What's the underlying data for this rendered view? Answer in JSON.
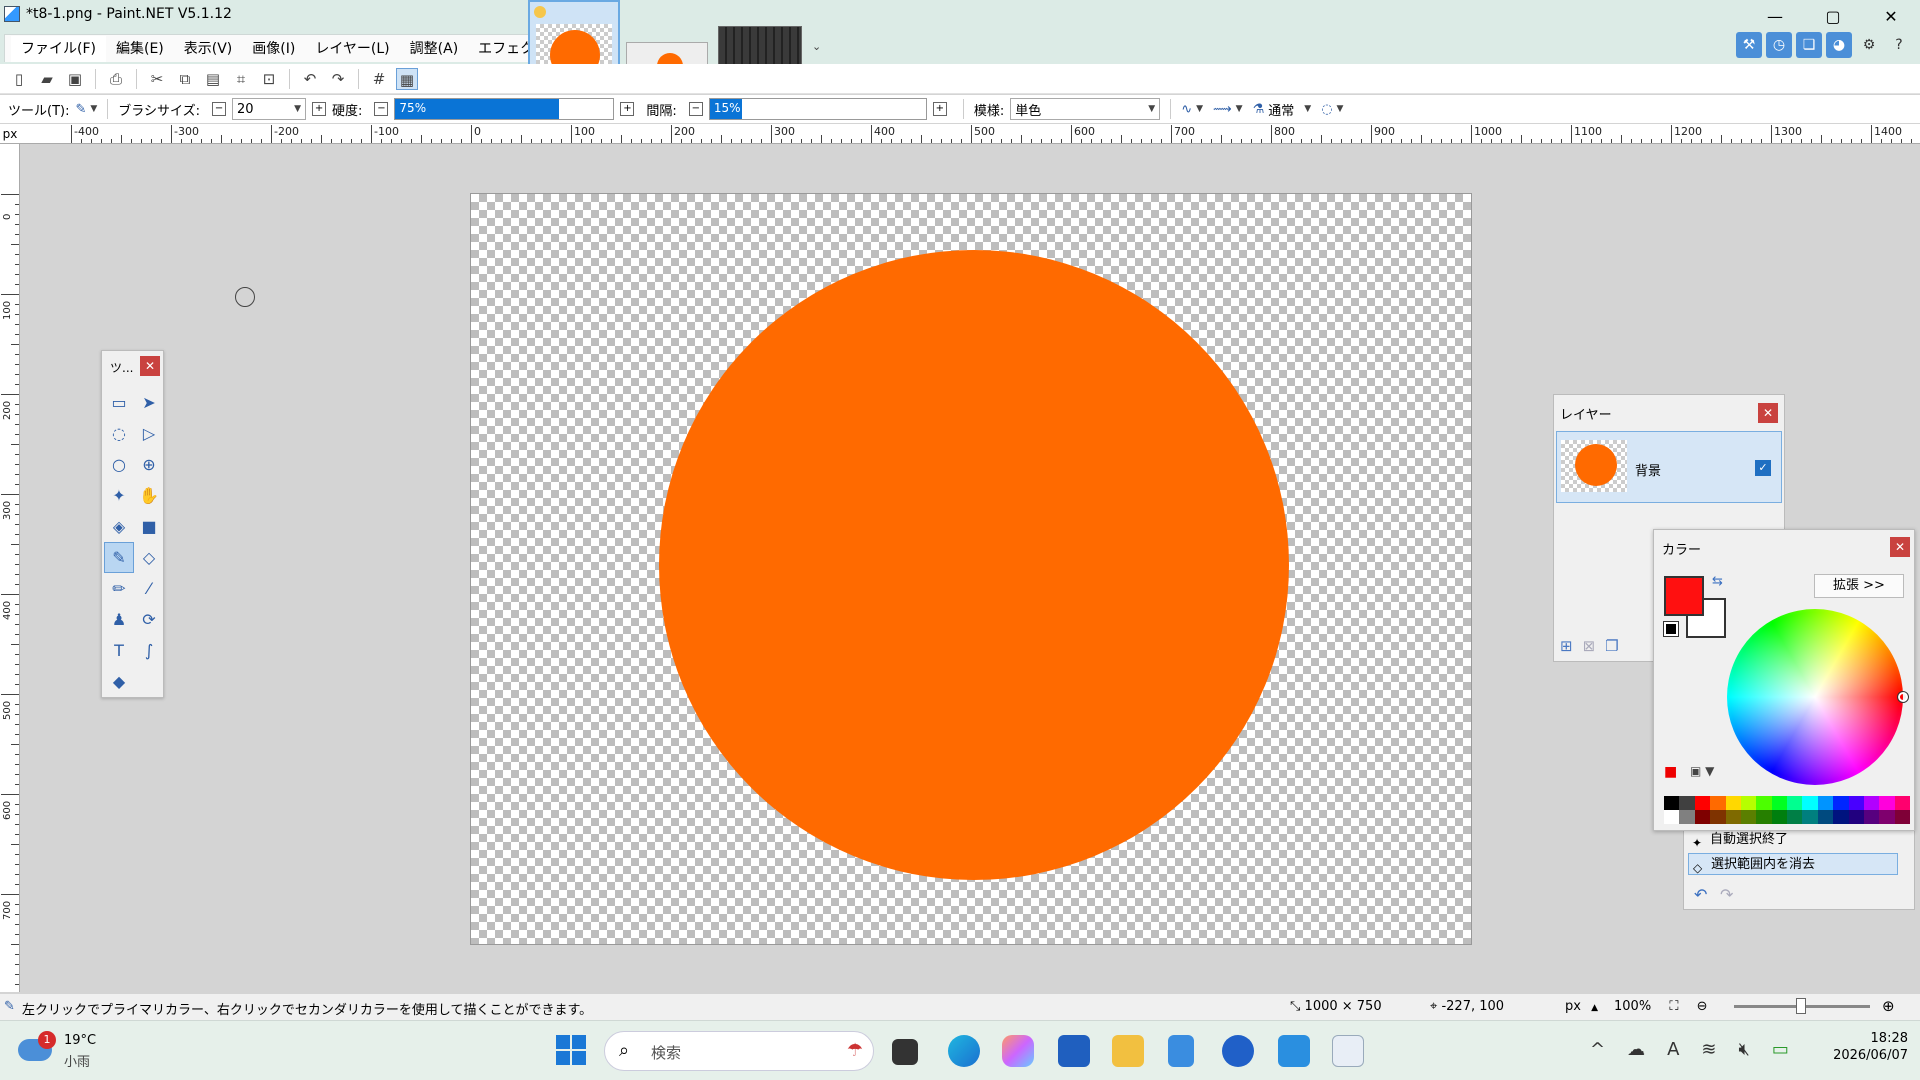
{
  "window": {
    "title": "*t8-1.png - Paint.NET V5.1.12",
    "controls": {
      "minimize": "—",
      "maximize": "▢",
      "close": "✕"
    }
  },
  "menu": {
    "items": [
      {
        "label": "ファイル(F)"
      },
      {
        "label": "編集(E)"
      },
      {
        "label": "表示(V)"
      },
      {
        "label": "画像(I)"
      },
      {
        "label": "レイヤー(L)"
      },
      {
        "label": "調整(A)"
      },
      {
        "label": "エフェクト(C)"
      }
    ]
  },
  "tool_options": {
    "tool_label": "ツール(T):",
    "brush_size_label": "ブラシサイズ:",
    "brush_size_value": "20",
    "hardness_label": "硬度:",
    "hardness_value": "75%",
    "hardness_fraction": 0.75,
    "spacing_label": "間隔:",
    "spacing_value": "15%",
    "spacing_fraction": 0.15,
    "pattern_label": "模様:",
    "pattern_value": "単色",
    "blend_mode": "通常"
  },
  "ruler": {
    "unit": "px",
    "h_labels": [
      "-400",
      "-300",
      "-200",
      "-100",
      "0",
      "100",
      "200",
      "300",
      "400",
      "500",
      "600",
      "700",
      "800",
      "900",
      "1000",
      "1100",
      "1200",
      "1300",
      "1400"
    ],
    "v_labels": [
      "0",
      "100",
      "200",
      "300",
      "400",
      "500",
      "600",
      "700"
    ]
  },
  "tools_panel": {
    "title": "ツ...",
    "close": "✕",
    "tools": [
      {
        "name": "rectangle-select-icon",
        "glyph": "▭"
      },
      {
        "name": "move-selected-icon",
        "glyph": "➤"
      },
      {
        "name": "lasso-select-icon",
        "glyph": "◌"
      },
      {
        "name": "move-selection-icon",
        "glyph": "▷"
      },
      {
        "name": "ellipse-select-icon",
        "glyph": "○"
      },
      {
        "name": "zoom-icon",
        "glyph": "⊕"
      },
      {
        "name": "magic-wand-icon",
        "glyph": "✦"
      },
      {
        "name": "pan-icon",
        "glyph": "✋"
      },
      {
        "name": "paint-bucket-icon",
        "glyph": "◈"
      },
      {
        "name": "gradient-icon",
        "glyph": "■"
      },
      {
        "name": "paintbrush-icon",
        "glyph": "✎",
        "active": true
      },
      {
        "name": "eraser-icon",
        "glyph": "◇"
      },
      {
        "name": "pencil-icon",
        "glyph": "✏"
      },
      {
        "name": "color-picker-icon",
        "glyph": "⁄"
      },
      {
        "name": "clone-stamp-icon",
        "glyph": "♟"
      },
      {
        "name": "recolor-icon",
        "glyph": "⟳"
      },
      {
        "name": "text-icon",
        "glyph": "T"
      },
      {
        "name": "line-curve-icon",
        "glyph": "∫"
      },
      {
        "name": "shapes-icon",
        "glyph": "◆"
      }
    ]
  },
  "layers_panel": {
    "title": "レイヤー",
    "close": "✕",
    "layer_name": "背景",
    "layer_visible": "✓"
  },
  "colors_panel": {
    "title": "カラー",
    "close": "✕",
    "expand_label": "拡張 >>",
    "primary_color": "#ff1010",
    "secondary_color": "#ffffff",
    "palette_top": [
      "#000000",
      "#404040",
      "#ff0000",
      "#ff6a00",
      "#ffd800",
      "#b6ff00",
      "#4cff00",
      "#00ff21",
      "#00ff90",
      "#00ffff",
      "#0094ff",
      "#0026ff",
      "#4800ff",
      "#b200ff",
      "#ff00dc",
      "#ff006e"
    ],
    "palette_bottom": [
      "#ffffff",
      "#808080",
      "#7f0000",
      "#7f3300",
      "#7f6a00",
      "#5b7f00",
      "#267f00",
      "#007f0e",
      "#007f46",
      "#007f7f",
      "#004a7f",
      "#00137f",
      "#21007f",
      "#57007f",
      "#7f006e",
      "#7f0037"
    ]
  },
  "history_panel": {
    "items": [
      {
        "label": "自動選択終了"
      },
      {
        "label": "選択範囲内を消去"
      }
    ]
  },
  "status": {
    "hint": "左クリックでプライマリカラー、右クリックでセカンダリカラーを使用して描くことができます。",
    "image_size": "1000 × 750",
    "cursor_pos": "-227, 100",
    "unit": "px",
    "zoom": "100%"
  },
  "taskbar": {
    "weather_temp": "19°C",
    "weather_desc": "小雨",
    "weather_badge": "1",
    "search_placeholder": "検索",
    "clock_time": "18:28",
    "clock_date": "2026/06/07"
  },
  "colors": {
    "circle": "#ff6a00",
    "accent": "#0a74d6"
  }
}
